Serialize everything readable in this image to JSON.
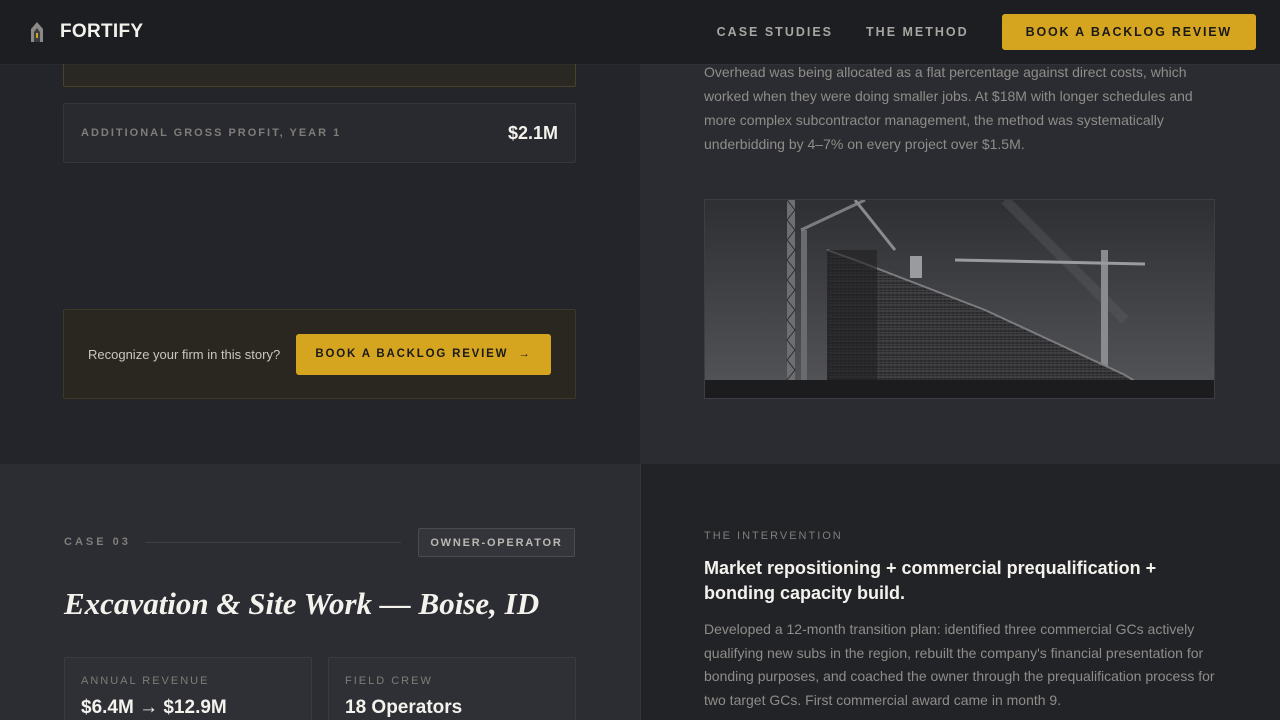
{
  "nav": {
    "brand": "FORTIFY",
    "links": [
      "CASE STUDIES",
      "THE METHOD"
    ],
    "cta": "BOOK A BACKLOG REVIEW"
  },
  "case02": {
    "metric_label": "ADDITIONAL GROSS PROFIT, YEAR 1",
    "metric_value": "$2.1M",
    "cta_text": "Recognize your firm in this story?",
    "cta_button": "BOOK A BACKLOG REVIEW",
    "cta_arrow": "→",
    "body_text": "Overhead was being allocated as a flat percentage against direct costs, which worked when they were doing smaller jobs. At $18M with longer schedules and more complex subcontractor management, the method was systematically underbidding by 4–7% on every project over $1.5M."
  },
  "case03": {
    "label": "CASE 03",
    "tag": "OWNER-OPERATOR",
    "title": "Excavation & Site Work — Boise, ID",
    "stats": [
      {
        "label": "ANNUAL REVENUE",
        "value": "$6.4M → $12.9M"
      },
      {
        "label": "FIELD CREW",
        "value": "18 Operators"
      }
    ],
    "intervention_label": "THE INTERVENTION",
    "intervention_heading": "Market repositioning + commercial prequalification + bonding capacity build.",
    "intervention_body": "Developed a 12-month transition plan: identified three commercial GCs actively qualifying new subs in the region, rebuilt the company's financial presentation for bonding purposes, and coached the owner through the prequalification process for two target GCs. First commercial award came in month 9."
  },
  "colors": {
    "accent": "#d6a51f",
    "background": "#27282c"
  }
}
